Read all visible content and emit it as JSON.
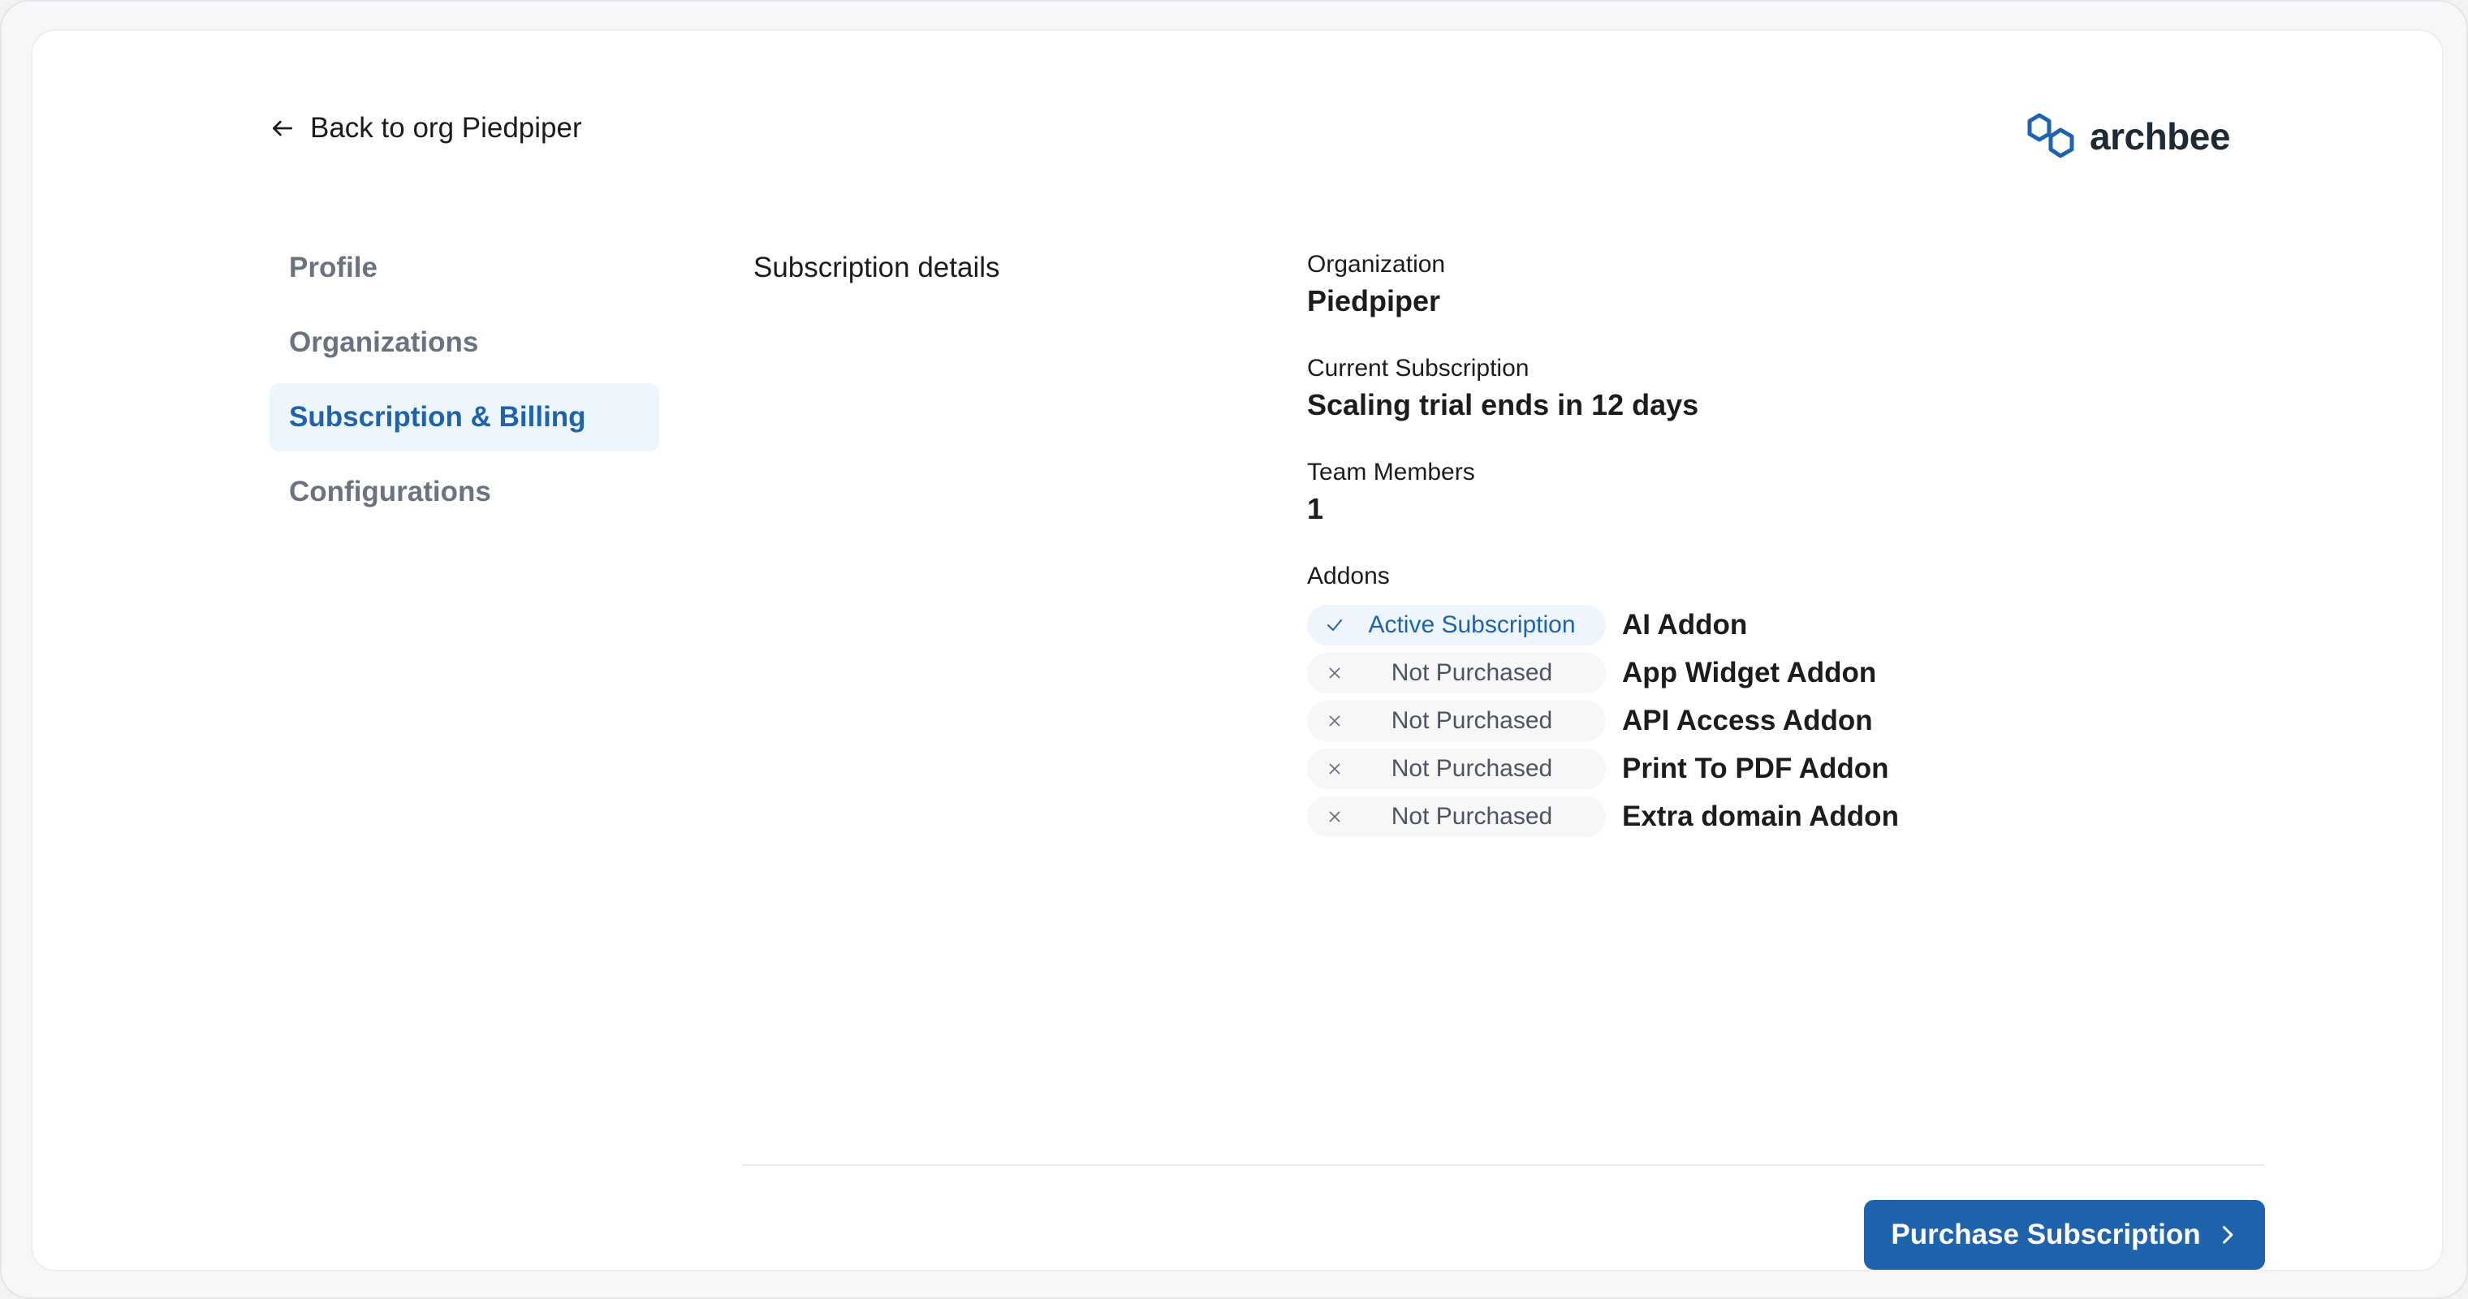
{
  "header": {
    "back_label": "Back to org Piedpiper",
    "back_icon": "arrow-left-icon",
    "logo_text": "archbee",
    "logo_icon": "archbee-hexagon-logo",
    "brand_color": "#1f63ad"
  },
  "sidebar": {
    "items": [
      {
        "label": "Profile",
        "active": false
      },
      {
        "label": "Organizations",
        "active": false
      },
      {
        "label": "Subscription & Billing",
        "active": true
      },
      {
        "label": "Configurations",
        "active": false
      }
    ]
  },
  "main": {
    "section_title": "Subscription details",
    "fields": [
      {
        "label": "Organization",
        "value": "Piedpiper"
      },
      {
        "label": "Current Subscription",
        "value": "Scaling trial ends in 12 days"
      },
      {
        "label": "Team Members",
        "value": "1"
      }
    ],
    "addons_label": "Addons",
    "addons": [
      {
        "status": "Active Subscription",
        "icon": "check-icon",
        "name": "AI Addon"
      },
      {
        "status": "Not Purchased",
        "icon": "x-icon",
        "name": "App Widget Addon"
      },
      {
        "status": "Not Purchased",
        "icon": "x-icon",
        "name": "API Access Addon"
      },
      {
        "status": "Not Purchased",
        "icon": "x-icon",
        "name": "Print To PDF Addon"
      },
      {
        "status": "Not Purchased",
        "icon": "x-icon",
        "name": "Extra domain Addon"
      }
    ]
  },
  "footer": {
    "purchase_label": "Purchase Subscription",
    "purchase_icon": "chevron-right-icon"
  }
}
